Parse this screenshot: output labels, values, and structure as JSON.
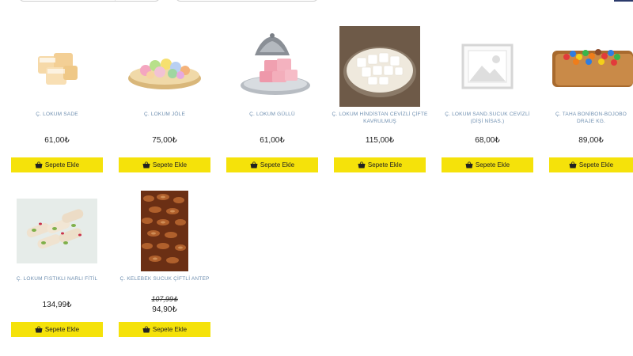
{
  "header": {
    "filter_select_1": "",
    "filter_select_2": ""
  },
  "products": [
    {
      "name": "Ç. LOKUM SADE",
      "price": "61,00₺",
      "button": "Sepete Ekle",
      "image": "plain-lokum-cubes"
    },
    {
      "name": "Ç. LOKUM JÖLE",
      "price": "75,00₺",
      "button": "Sepete Ekle",
      "image": "jelly-lokum-bowl"
    },
    {
      "name": "Ç. LOKUM GÜLLÜ",
      "price": "61,00₺",
      "button": "Sepete Ekle",
      "image": "rose-lokum-silver-dish"
    },
    {
      "name": "Ç. LOKUM HİNDİSTAN CEVİZLİ ÇİFTE KAVRULMUŞ",
      "price": "115,00₺",
      "button": "Sepete Ekle",
      "image": "coconut-lokum-plate"
    },
    {
      "name": "Ç. LOKUM SAND.SUCUK CEVİZLİ (DİŞİ NİSAS.)",
      "price": "68,00₺",
      "button": "Sepete Ekle",
      "image": "image-placeholder-icon"
    },
    {
      "name": "Ç. TAHA BONİBON-BOJOBO DRAJE KG.",
      "price": "89,00₺",
      "button": "Sepete Ekle",
      "image": "candy-dragee-box"
    },
    {
      "name": "Ç. LOKUM FISTIKLI NARLI FİTİL",
      "price": "134,99₺",
      "button": "Sepete Ekle",
      "image": "pistachio-lokum-rolls"
    },
    {
      "name": "Ç. KELEBEK SUCUK ÇİFTLİ ANTEP",
      "old_price": "107,99₺",
      "price": "94,90₺",
      "button": "Sepete Ekle",
      "image": "walnut-sucuk-pile"
    }
  ],
  "colors": {
    "button_bg": "#f5e20a",
    "product_name": "#6f8fb0",
    "corner_accent": "#2b3a6b"
  }
}
